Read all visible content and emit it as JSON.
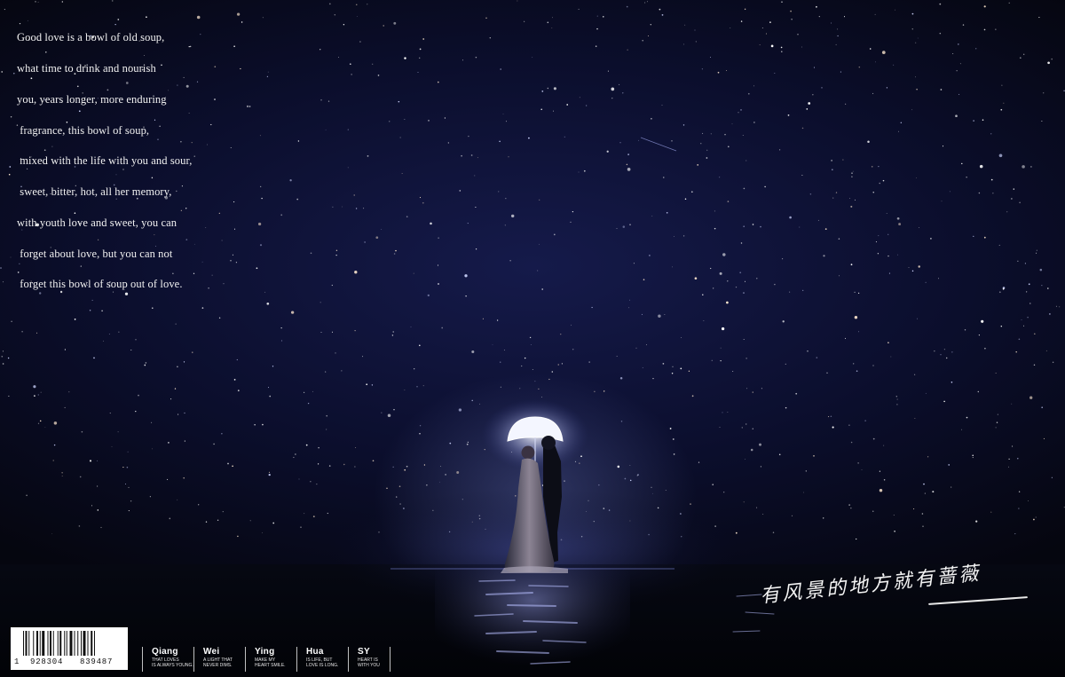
{
  "poem": {
    "lines": [
      "Good love is a bowl of old soup,",
      "what time to drink and nourish",
      "you, years longer, more enduring",
      " fragrance, this bowl of soup,",
      " mixed with the life with you and sour,",
      " sweet, bitter, hot, all her memory,",
      "with youth love and sweet, you can",
      " forget about love, but you can not",
      " forget this bowl of soup out of love."
    ]
  },
  "calligraphy": {
    "text": "有风景的地方就有蔷薇"
  },
  "barcode": {
    "lead_digit": "1",
    "group1": "928304",
    "group2": "839487"
  },
  "brands": [
    {
      "name": "Qiang",
      "tag": "THAT LOVES\nIS ALWAYS YOUNG."
    },
    {
      "name": "Wei",
      "tag": "A LIGHT THAT\nNEVER DIMS."
    },
    {
      "name": "Ying",
      "tag": "MAKE MY\nHEART SMILE."
    },
    {
      "name": "Hua",
      "tag": "IS LIFE, BUT\nLOVE IS LONG."
    },
    {
      "name": "SY",
      "tag": "HEART IS\nWITH YOU"
    }
  ],
  "colors": {
    "sky_top": "#0b0e2c",
    "sky_glow": "#151a4a",
    "sea": "#060812",
    "umbrella_glow": "#e9ecff",
    "text": "#f2f2f2"
  }
}
